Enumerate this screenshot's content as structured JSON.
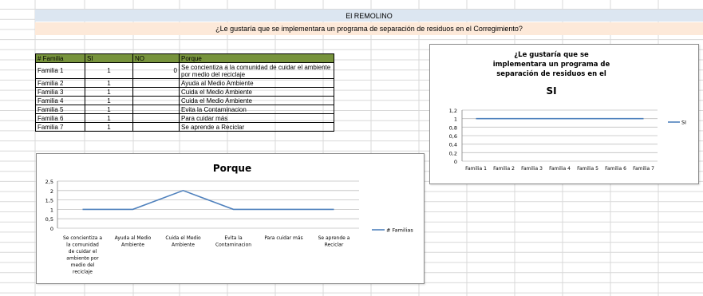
{
  "sheet": {
    "title": "El REMOLINO",
    "question": "¿Le gustaría que se implementara un programa de separación de residuos en el Corregimiento?"
  },
  "table": {
    "headers": [
      "# Familia",
      "SI",
      "NO",
      "Porque"
    ],
    "rows": [
      {
        "familia": "Familia 1",
        "si": "1",
        "no": "0",
        "porque": "Se concientiza a la comunidad de cuidar el ambiente por medio del reciclaje"
      },
      {
        "familia": "Familia 2",
        "si": "1",
        "no": "",
        "porque": "Ayuda al Medio Ambiente"
      },
      {
        "familia": "Familia 3",
        "si": "1",
        "no": "",
        "porque": "Cuida el Medio Ambiente"
      },
      {
        "familia": "Familia 4",
        "si": "1",
        "no": "",
        "porque": "Cuida el Medio Ambiente"
      },
      {
        "familia": "Familia 5",
        "si": "1",
        "no": "",
        "porque": "Evita la Contaminacion"
      },
      {
        "familia": "Familia 6",
        "si": "1",
        "no": "",
        "porque": "Para cuidar más"
      },
      {
        "familia": "Familia 7",
        "si": "1",
        "no": "",
        "porque": "Se aprende a Reciclar"
      }
    ]
  },
  "colors": {
    "title_band": "#dce6f1",
    "question_band": "#fde9d9",
    "header_fill": "#77933c",
    "series_line": "#4f81bd",
    "gridline": "#bfbfbf"
  },
  "chart_data": [
    {
      "type": "line",
      "title_lines": [
        "¿Le gustaría que se",
        "implementara un programa de",
        "separación de residuos en el"
      ],
      "title": "SI",
      "categories": [
        "Familia 1",
        "Familia 2",
        "Familia 3",
        "Familia 4",
        "Familia 5",
        "Familia 6",
        "Familia 7"
      ],
      "series": [
        {
          "name": "SI",
          "values": [
            1,
            1,
            1,
            1,
            1,
            1,
            1
          ]
        }
      ],
      "y_ticks": [
        "0",
        "0,2",
        "0,4",
        "0,6",
        "0,8",
        "1",
        "1,2"
      ],
      "ylim": [
        0,
        1.2
      ],
      "grid": true,
      "legend": "right"
    },
    {
      "type": "line",
      "title": "Porque",
      "categories": [
        [
          "Se concientiza a",
          "la comunidad",
          "de cuidar el",
          "ambiente por",
          "medio del",
          "reciclaje"
        ],
        [
          "Ayuda al Medio",
          "Ambiente"
        ],
        [
          "Cuida el Medio",
          "Ambiente"
        ],
        [
          "Evita la",
          "Contaminacion"
        ],
        [
          "Para cuidar más"
        ],
        [
          "Se aprende a",
          "Reciclar"
        ]
      ],
      "series": [
        {
          "name": "# Familias",
          "values": [
            1,
            1,
            2,
            1,
            1,
            1
          ]
        }
      ],
      "y_ticks": [
        "0",
        "0,5",
        "1",
        "1,5",
        "2",
        "2,5"
      ],
      "ylim": [
        0,
        2.5
      ],
      "grid": true,
      "legend": "right"
    }
  ]
}
